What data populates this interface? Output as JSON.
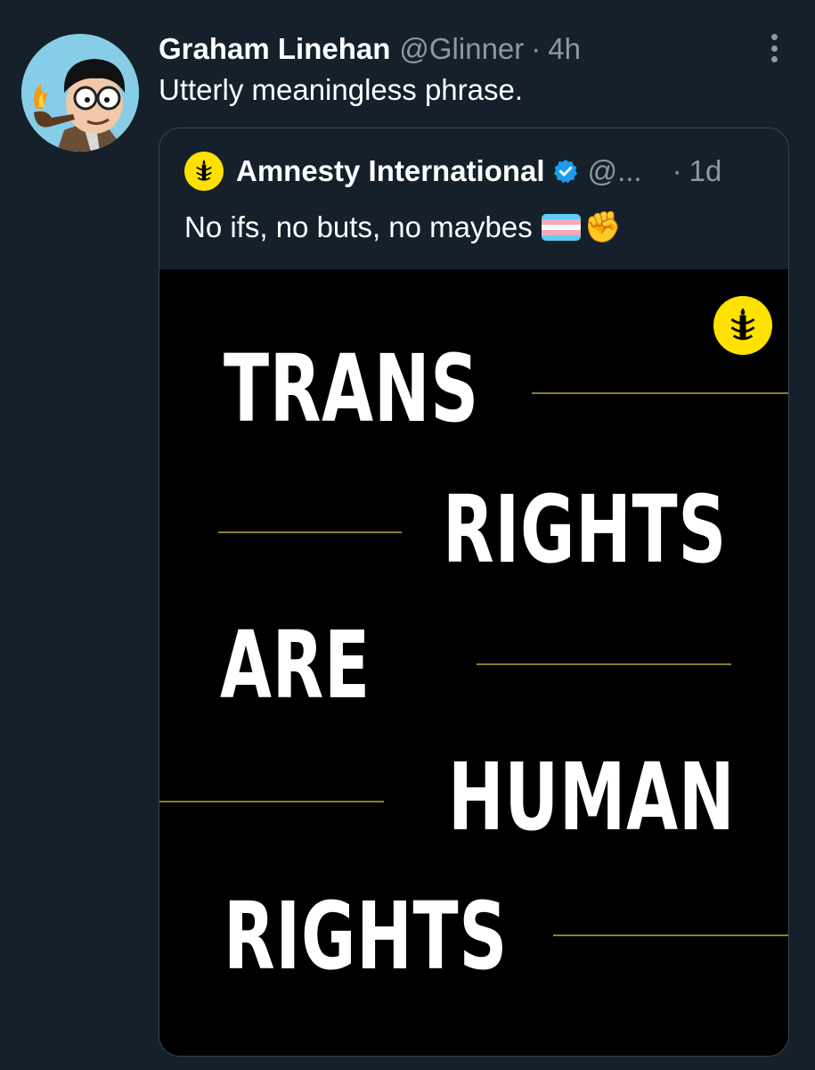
{
  "tweet": {
    "author_name": "Graham Linehan",
    "handle": "@Glinner",
    "separator": "·",
    "time": "4h",
    "text": "Utterly meaningless phrase.",
    "avatar_icon": "cartoon-avatar"
  },
  "quoted_tweet": {
    "author_name": "Amnesty International",
    "verified": true,
    "handle": "@...",
    "separator": "·",
    "time": "1d",
    "text": "No ifs, no buts, no maybes",
    "emoji": "✊",
    "avatar_icon": "amnesty-candle-logo"
  },
  "poster": {
    "lines": [
      "TRANS",
      "RIGHTS",
      "ARE",
      "HUMAN",
      "RIGHTS"
    ],
    "logo_icon": "amnesty-candle-logo"
  },
  "colors": {
    "background": "#15202b",
    "secondary_text": "#8b98a5",
    "amnesty_yellow": "#ffe100",
    "verified_blue": "#1d9bf0",
    "rule_gold": "#8a7f2e"
  }
}
